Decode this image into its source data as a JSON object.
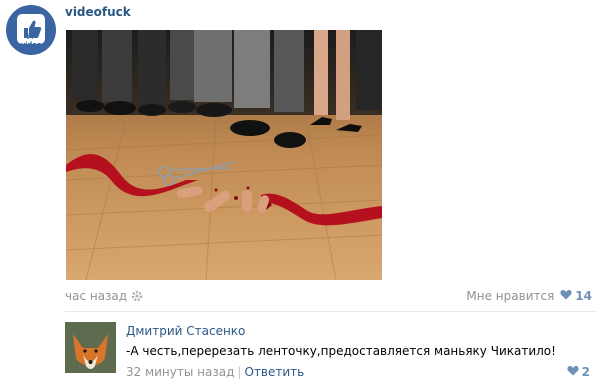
{
  "post": {
    "author": "videofuck",
    "avatar_icon": "thumbs-up-logo-icon",
    "avatar_text": "i♥ video",
    "photo_description_icon": "photo-image",
    "time": "час назад",
    "like_label": "Мне нравится",
    "like_count": "14"
  },
  "comment": {
    "author": "Дмитрий Стасенко",
    "text": "-А честь,перерезать ленточку,предоставляется маньяку Чикатило!",
    "time": "32 минуты назад",
    "separator": "|",
    "reply_label": "Ответить",
    "like_count": "2"
  },
  "colors": {
    "link": "#2a5885",
    "meta": "#939393",
    "heart": "#6f8fb5",
    "brand": "#3a64a2"
  }
}
